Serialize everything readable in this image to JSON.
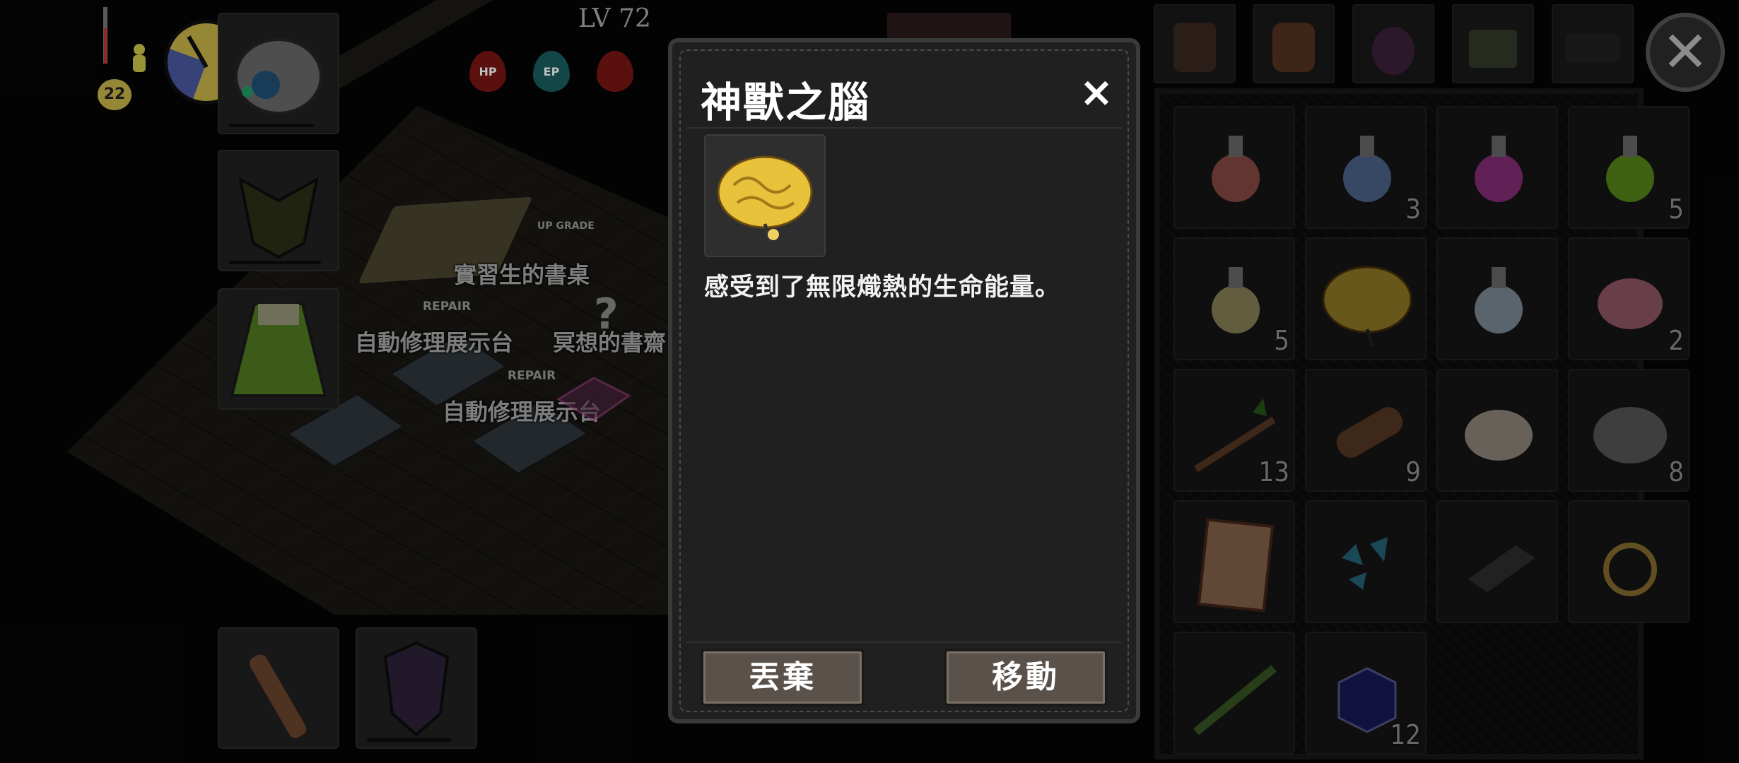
{
  "hud": {
    "temperature": "22",
    "level": "LV 72",
    "stats": [
      {
        "label": "HP",
        "color": "#8a1a1a"
      },
      {
        "label": "EP",
        "color": "#1d6b6b"
      },
      {
        "label": "",
        "color": "#8a1a1a"
      }
    ]
  },
  "scene": {
    "labels": {
      "desk": "實習生的書桌",
      "repair_station_1": "自動修理展示台",
      "meditation_desk": "冥想的書齋",
      "repair_station_2": "自動修理展示台"
    },
    "tags": {
      "upgrade": "UP GRADE",
      "repair_1": "REPAIR",
      "repair_2": "REPAIR"
    }
  },
  "equipment": {
    "slots": [
      {
        "icon": "steel-helmet-icon"
      },
      {
        "icon": "spiked-armor-icon"
      },
      {
        "icon": "green-cloak-icon"
      },
      {
        "icon": "wooden-club-icon"
      },
      {
        "icon": "demon-shield-icon"
      }
    ]
  },
  "bag_tabs": [
    {
      "icon": "backpack-icon"
    },
    {
      "icon": "leather-bag-icon"
    },
    {
      "icon": "pouch-icon"
    },
    {
      "icon": "satchel-icon"
    },
    {
      "icon": "horse-saddlebag-icon"
    }
  ],
  "inventory": {
    "items": [
      {
        "icon": "red-potion-icon",
        "count": ""
      },
      {
        "icon": "blue-potion-icon",
        "count": "3"
      },
      {
        "icon": "pink-potion-icon",
        "count": ""
      },
      {
        "icon": "green-potion-icon",
        "count": "5"
      },
      {
        "icon": "yellow-potion-icon",
        "count": "5"
      },
      {
        "icon": "golden-brain-icon",
        "count": ""
      },
      {
        "icon": "white-potion-icon",
        "count": ""
      },
      {
        "icon": "pink-egg-icon",
        "count": "2"
      },
      {
        "icon": "branch-icon",
        "count": "13"
      },
      {
        "icon": "log-icon",
        "count": "9"
      },
      {
        "icon": "white-stone-icon",
        "count": ""
      },
      {
        "icon": "gray-rock-icon",
        "count": "8"
      },
      {
        "icon": "scroll-icon",
        "count": ""
      },
      {
        "icon": "blue-crystal-shards-icon",
        "count": ""
      },
      {
        "icon": "iron-ingot-icon",
        "count": ""
      },
      {
        "icon": "gold-ring-icon",
        "count": ""
      },
      {
        "icon": "herb-bundle-icon",
        "count": ""
      },
      {
        "icon": "purple-cube-icon",
        "count": "12"
      }
    ]
  },
  "modal": {
    "title": "神獸之腦",
    "close": "×",
    "item_icon": "golden-brain-icon",
    "description": "感受到了無限熾熱的生命能量。",
    "discard_label": "丟棄",
    "move_label": "移動"
  }
}
